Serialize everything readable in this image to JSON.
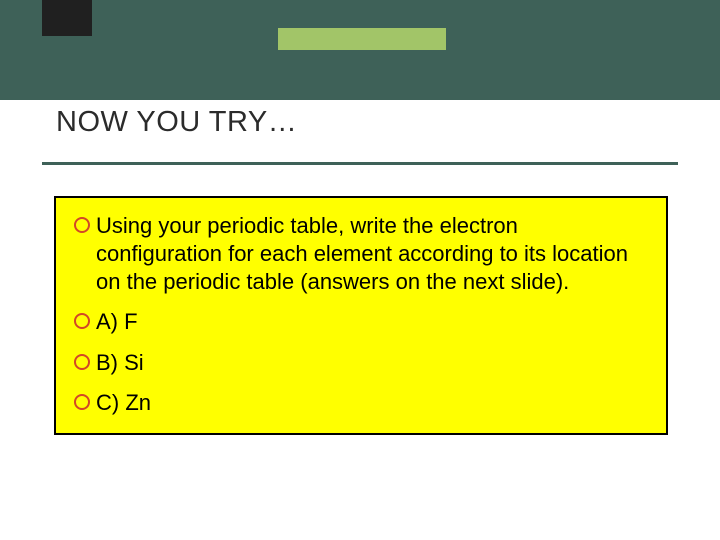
{
  "title": "NOW YOU TRY…",
  "content": {
    "intro": "Using your periodic table, write the electron configuration for each element according to its location on the periodic table (answers on the next slide).",
    "items": [
      {
        "label": "A) F"
      },
      {
        "label": "B) Si"
      },
      {
        "label": "C) Zn"
      }
    ]
  }
}
